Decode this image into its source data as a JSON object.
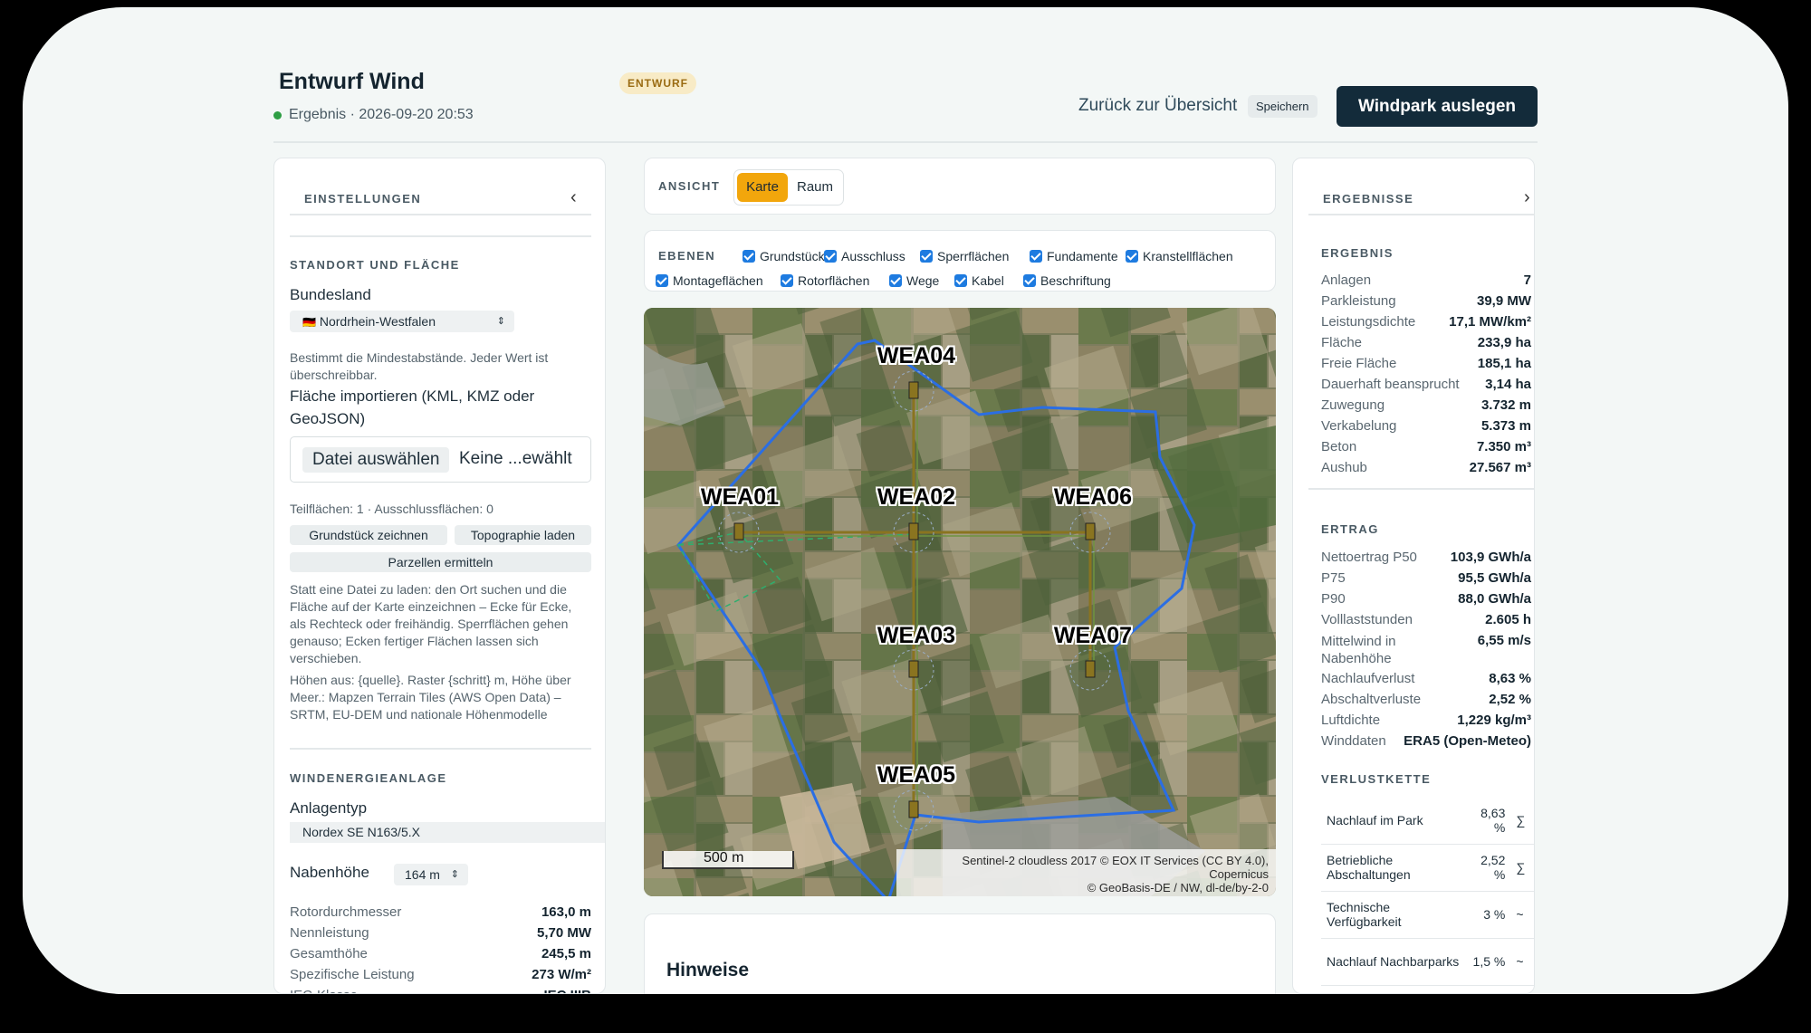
{
  "header": {
    "title": "Entwurf Wind",
    "status_text": "Ergebnis · 2026-09-20 20:53",
    "badge": "ENTWURF",
    "back_link": "Zurück zur Übersicht",
    "save_label": "Speichern",
    "primary_label": "Windpark auslegen"
  },
  "settings": {
    "title": "EINSTELLUNGEN",
    "collapse_icon": "‹",
    "site_section": "STANDORT UND FLÄCHE",
    "state_label": "Bundesland",
    "state_value": "Nordrhein-Westfalen",
    "state_flag": "🇩🇪",
    "state_hint": "Bestimmt die Mindestabstände. Jeder Wert ist überschreibbar.",
    "import_label": "Fläche importieren (KML, KMZ oder GeoJSON)",
    "file_button": "Datei auswählen",
    "file_status": "Keine ...ewählt",
    "counts": "Teilflächen: 1 · Ausschlussflächen: 0",
    "btn_draw": "Grundstück zeichnen",
    "btn_topo": "Topographie laden",
    "btn_parcels": "Parzellen ermitteln",
    "draw_hint": "Statt eine Datei zu laden: den Ort suchen und die Fläche auf der Karte einzeichnen – Ecke für Ecke, als Rechteck oder freihändig. Sperrflächen gehen genauso; Ecken fertiger Flächen lassen sich verschieben.",
    "height_hint": "Höhen aus: {quelle}. Raster {schritt} m, Höhe über Meer.: Mapzen Terrain Tiles (AWS Open Data) – SRTM, EU-DEM und nationale Höhenmodelle",
    "turbine_section": "WINDENERGIEANLAGE",
    "type_label": "Anlagentyp",
    "type_value": "Nordex SE N163/5.X",
    "hub_label": "Nabenhöhe",
    "hub_value": "164 m",
    "specs": [
      {
        "k": "Rotordurchmesser",
        "v": "163,0 m"
      },
      {
        "k": "Nennleistung",
        "v": "5,70 MW"
      },
      {
        "k": "Gesamthöhe",
        "v": "245,5 m"
      },
      {
        "k": "Spezifische Leistung",
        "v": "273 W/m²"
      },
      {
        "k": "IEC-Klasse",
        "v": "IEC IIIB"
      }
    ]
  },
  "view": {
    "label": "ANSICHT",
    "tab_map": "Karte",
    "tab_room": "Raum",
    "active": "Karte"
  },
  "layers": {
    "label": "EBENEN",
    "items": [
      "Grundstück",
      "Ausschluss",
      "Sperrflächen",
      "Fundamente",
      "Kranstellflächen",
      "Montageflächen",
      "Rotorflächen",
      "Wege",
      "Kabel",
      "Beschriftung"
    ]
  },
  "map": {
    "turbines": [
      "WEA04",
      "WEA01",
      "WEA02",
      "WEA06",
      "WEA03",
      "WEA07",
      "WEA05"
    ],
    "scale": "500 m",
    "attribution_1": "Sentinel-2 cloudless 2017 © EOX IT Services (CC BY 4.0), Copernicus",
    "attribution_2": "© GeoBasis-DE / NW, dl-de/by-2-0"
  },
  "notes": {
    "title": "Hinweise"
  },
  "results": {
    "title": "ERGEBNISSE",
    "expand_icon": "›",
    "result_section": "ERGEBNIS",
    "result_rows": [
      {
        "k": "Anlagen",
        "v": "7"
      },
      {
        "k": "Parkleistung",
        "v": "39,9 MW"
      },
      {
        "k": "Leistungsdichte",
        "v": "17,1 MW/km²"
      },
      {
        "k": "Fläche",
        "v": "233,9 ha"
      },
      {
        "k": "Freie Fläche",
        "v": "185,1 ha"
      },
      {
        "k": "Dauerhaft beansprucht",
        "v": "3,14 ha"
      },
      {
        "k": "Zuwegung",
        "v": "3.732 m"
      },
      {
        "k": "Verkabelung",
        "v": "5.373 m"
      },
      {
        "k": "Beton",
        "v": "7.350 m³"
      },
      {
        "k": "Aushub",
        "v": "27.567 m³"
      }
    ],
    "yield_section": "ERTRAG",
    "yield_rows": [
      {
        "k": "Nettoertrag P50",
        "v": "103,9 GWh/a"
      },
      {
        "k": "P75",
        "v": "95,5 GWh/a"
      },
      {
        "k": "P90",
        "v": "88,0 GWh/a"
      },
      {
        "k": "Volllaststunden",
        "v": "2.605 h"
      },
      {
        "k": "Mittelwind in Nabenhöhe",
        "v": "6,55 m/s"
      },
      {
        "k": "Nachlaufverlust",
        "v": "8,63 %"
      },
      {
        "k": "Abschaltverluste",
        "v": "2,52 %"
      },
      {
        "k": "Luftdichte",
        "v": "1,229 kg/m³"
      },
      {
        "k": "Winddaten",
        "v": "ERA5 (Open-Meteo)"
      }
    ],
    "loss_section": "VERLUSTKETTE",
    "loss_rows": [
      {
        "k": "Nachlauf im Park",
        "v": "8,63 %",
        "m": "∑"
      },
      {
        "k": "Betriebliche Abschaltungen",
        "v": "2,52 %",
        "m": "∑"
      },
      {
        "k": "Technische Verfügbarkeit",
        "v": "3 %",
        "m": "~"
      },
      {
        "k": "Nachlauf Nachbarparks",
        "v": "1,5 %",
        "m": "~"
      }
    ]
  }
}
